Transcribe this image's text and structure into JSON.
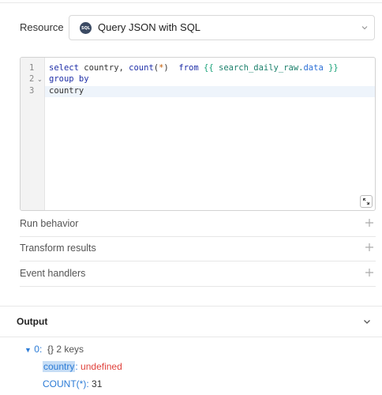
{
  "resource": {
    "label": "Resource",
    "badge": "SQL",
    "value": "Query JSON with SQL"
  },
  "editor": {
    "line_numbers": [
      "1",
      "2",
      "3"
    ],
    "lines": {
      "l1_kw_select": "select",
      "l1_columns": " country, ",
      "l1_fn": "count",
      "l1_paren_open": "(",
      "l1_star": "*",
      "l1_paren_close": ")",
      "l1_gap": "  ",
      "l1_from": "from",
      "l1_sp": " ",
      "l1_open": "{{",
      "l1_var": " search_daily_raw.",
      "l1_prop": "data",
      "l1_close": " }}",
      "l2": "group by",
      "l3": "country"
    }
  },
  "sections": [
    {
      "label": "Run behavior"
    },
    {
      "label": "Transform results"
    },
    {
      "label": "Event handlers"
    }
  ],
  "output": {
    "label": "Output",
    "tree": {
      "index": "0:",
      "braces": "{}",
      "key_count": "2 keys",
      "rows": [
        {
          "key": "country",
          "colon": ":",
          "value": "undefined"
        },
        {
          "key": "COUNT(*)",
          "colon": ":",
          "value": "31"
        }
      ]
    }
  },
  "colors": {
    "keyword": "#1f2fa8",
    "template": "#1aa37a",
    "key": "#2b7bd6",
    "undefined": "#e0423c"
  }
}
